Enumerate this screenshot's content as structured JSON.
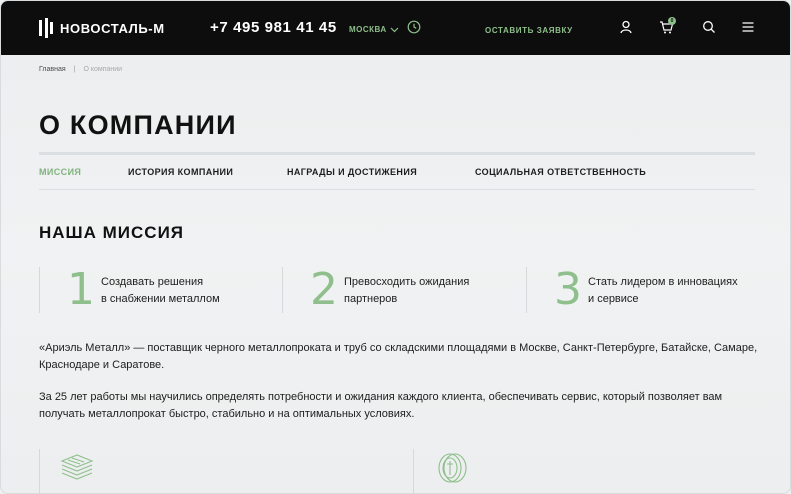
{
  "header": {
    "logo_text": "НОВОСТАЛЬ-М",
    "phone": "+7 495 981 41 45",
    "city": "МОСКВА",
    "request_label": "ОСТАВИТЬ ЗАЯВКУ",
    "cart_count": "0",
    "icons": [
      "logo-icon",
      "chevron-down-icon",
      "clock-icon",
      "user-icon",
      "cart-icon",
      "search-icon",
      "menu-icon"
    ]
  },
  "breadcrumb": {
    "home": "Главная",
    "separator": "|",
    "current": "О компании"
  },
  "page_title": "О КОМПАНИИ",
  "tabs": [
    {
      "label": "МИССИЯ",
      "active": true
    },
    {
      "label": "ИСТОРИЯ КОМПАНИИ",
      "active": false
    },
    {
      "label": "НАГРАДЫ И ДОСТИЖЕНИЯ",
      "active": false
    },
    {
      "label": "СОЦИАЛЬНАЯ ОТВЕТСТВЕННОСТЬ",
      "active": false
    }
  ],
  "mission": {
    "title": "НАША МИССИЯ",
    "goals": [
      {
        "number": "1",
        "line1": "Создавать решения",
        "line2": "в снабжении металлом"
      },
      {
        "number": "2",
        "line1": "Превосходить ожидания",
        "line2": "партнеров"
      },
      {
        "number": "3",
        "line1": "Стать лидером в инновациях",
        "line2": "и сервисе"
      }
    ],
    "paragraphs": [
      "«Ариэль Металл» — поставщик черного металлопроката и труб со складскими площадями в Москве, Санкт-Петербурге, Батайске, Самаре, Краснодаре и Саратове.",
      "За 25 лет работы мы научились определять потребности и ожидания каждого клиента, обеспечивать сервис, который позволяет вам получать металлопрокат быстро, стабильно и на оптимальных условиях."
    ]
  },
  "bottom_icons": [
    "stacked-sheets-icon",
    "coin-stack-icon"
  ],
  "colors": {
    "header_bg": "#0d0d0d",
    "accent": "#8fbf8c",
    "page_bg": "#eef0f1"
  }
}
